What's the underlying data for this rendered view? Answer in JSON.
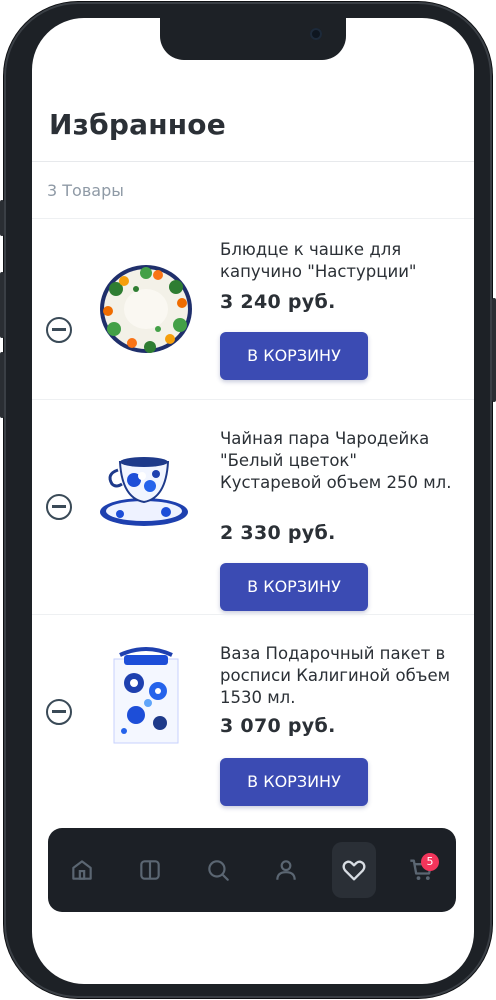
{
  "header": {
    "title": "Избранное"
  },
  "summary": {
    "count_label": "3 Товары"
  },
  "items": [
    {
      "name": "Блюдце к чашке для капучино \"Настурции\"",
      "price": "3 240  руб.",
      "cart_label": "В КОРЗИНУ"
    },
    {
      "name": "Чайная пара Чародейка \"Белый цветок\" Кустаревой объем 250 мл.",
      "price": "2 330  руб.",
      "cart_label": "В КОРЗИНУ"
    },
    {
      "name": "Ваза Подарочный пакет в росписи Калигиной объем 1530 мл.",
      "price": "3 070  руб.",
      "cart_label": "В КОРЗИНУ"
    }
  ],
  "navbar": {
    "items": [
      {
        "icon": "home-icon"
      },
      {
        "icon": "catalog-icon"
      },
      {
        "icon": "search-icon"
      },
      {
        "icon": "profile-icon"
      },
      {
        "icon": "favorites-heart-icon",
        "active": true
      },
      {
        "icon": "cart-icon"
      }
    ],
    "cart_badge": "5"
  },
  "colors": {
    "accent": "#3b4bb3",
    "badge": "#f2355b",
    "navbar_bg": "#1c2026"
  }
}
